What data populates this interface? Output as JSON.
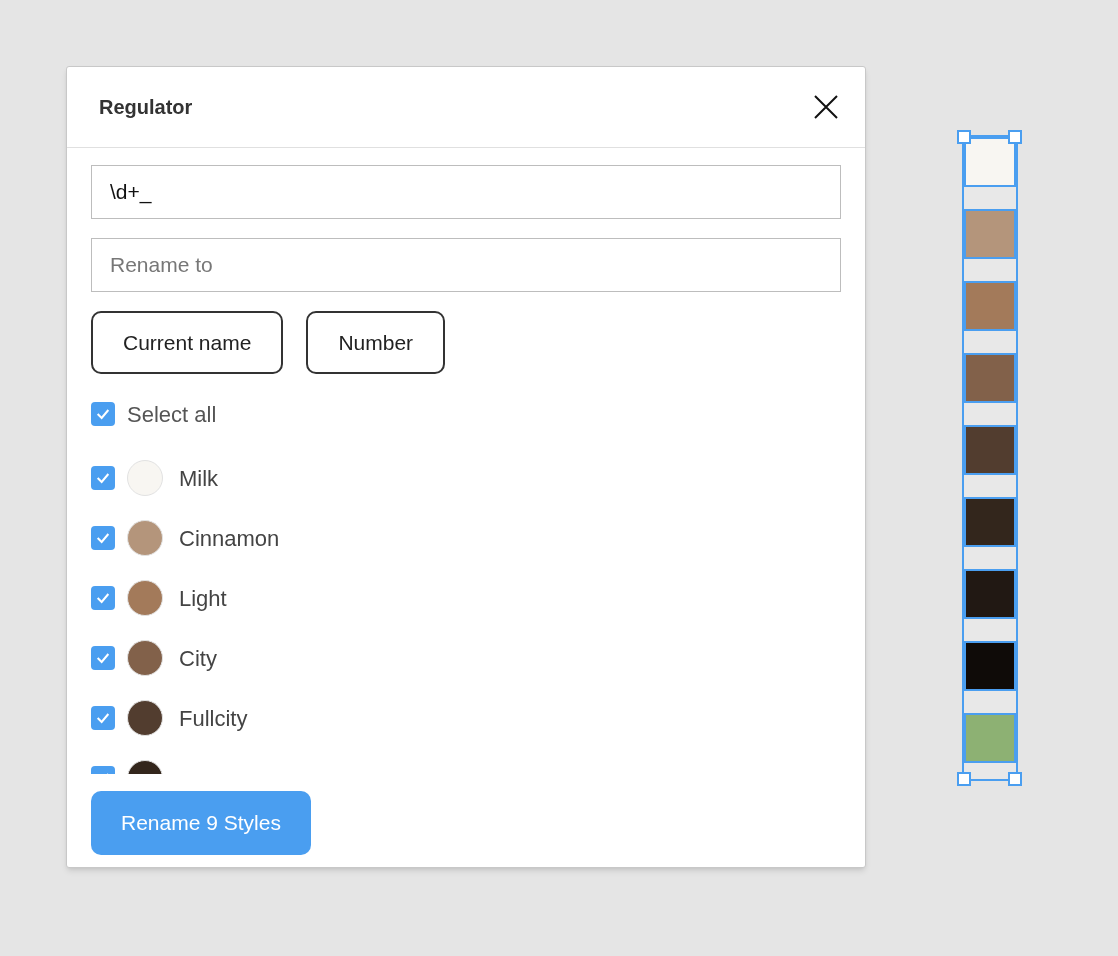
{
  "dialog": {
    "title": "Regulator",
    "find_field": {
      "value": "\\d+_"
    },
    "rename_field": {
      "placeholder": "Rename to"
    },
    "insert_buttons": [
      "Current name",
      "Number"
    ],
    "select_all": {
      "label": "Select all",
      "checked": true
    },
    "styles": [
      {
        "label": "Milk",
        "checked": true,
        "color": "#f8f6f2"
      },
      {
        "label": "Cinnamon",
        "checked": true,
        "color": "#b4957b"
      },
      {
        "label": "Light",
        "checked": true,
        "color": "#a37a5a"
      },
      {
        "label": "City",
        "checked": true,
        "color": "#82614a"
      },
      {
        "label": "Fullcity",
        "checked": true,
        "color": "#523d2f"
      },
      {
        "checked": true,
        "color": "#33261c"
      }
    ],
    "action_button": "Rename 9 Styles"
  },
  "canvas": {
    "swatches": [
      {
        "color": "#f8f6f2"
      },
      {
        "color": "#b4957b"
      },
      {
        "color": "#a37a5a"
      },
      {
        "color": "#82614a"
      },
      {
        "color": "#523d2f"
      },
      {
        "color": "#33261c"
      },
      {
        "color": "#211813"
      },
      {
        "color": "#0f0b08"
      },
      {
        "color": "#8db173"
      }
    ]
  }
}
